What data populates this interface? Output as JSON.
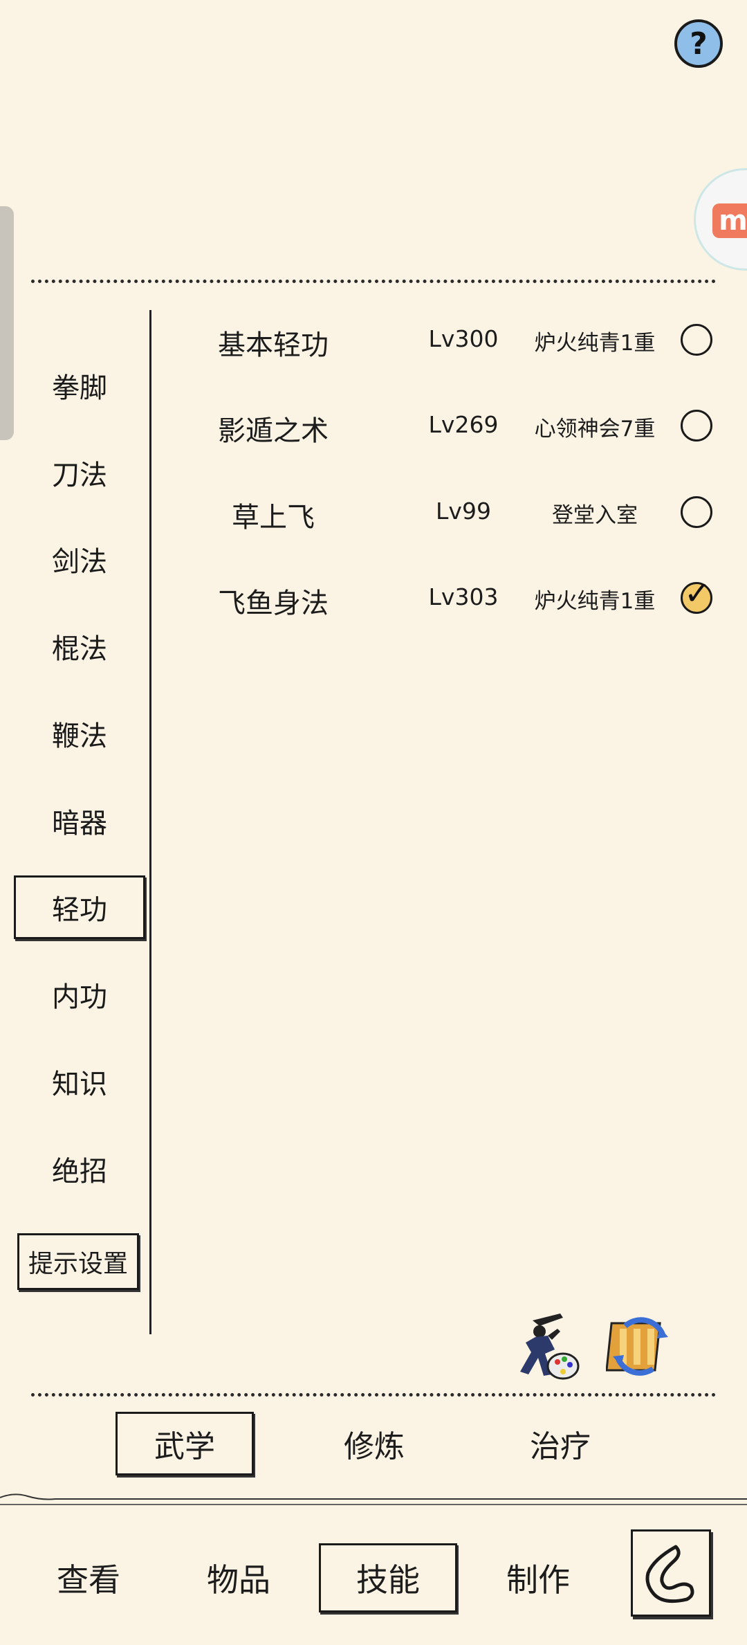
{
  "help": {
    "icon": "question-circle-icon",
    "label": "?"
  },
  "float_badge": {
    "icon": "app-logo-icon",
    "label": "m"
  },
  "categories": [
    {
      "label": "拳脚",
      "active": false
    },
    {
      "label": "刀法",
      "active": false
    },
    {
      "label": "剑法",
      "active": false
    },
    {
      "label": "棍法",
      "active": false
    },
    {
      "label": "鞭法",
      "active": false
    },
    {
      "label": "暗器",
      "active": false
    },
    {
      "label": "轻功",
      "active": true
    },
    {
      "label": "内功",
      "active": false
    },
    {
      "label": "知识",
      "active": false
    },
    {
      "label": "绝招",
      "active": false
    }
  ],
  "hint_button": "提示设置",
  "skills": [
    {
      "name": "基本轻功",
      "level": "Lv300",
      "rank": "炉火纯青1重",
      "equipped": false
    },
    {
      "name": "影遁之术",
      "level": "Lv269",
      "rank": "心领神会7重",
      "equipped": false
    },
    {
      "name": "草上飞",
      "level": "Lv99",
      "rank": "登堂入室",
      "equipped": false
    },
    {
      "name": "飞鱼身法",
      "level": "Lv303",
      "rank": "炉火纯青1重",
      "equipped": true
    }
  ],
  "tools": {
    "martial_icon": "swordsman-palette-icon",
    "scroll_icon": "scroll-swap-icon"
  },
  "subtabs": [
    {
      "label": "武学",
      "active": true
    },
    {
      "label": "修炼",
      "active": false
    },
    {
      "label": "治疗",
      "active": false
    }
  ],
  "navtabs": [
    {
      "label": "查看",
      "active": false
    },
    {
      "label": "物品",
      "active": false
    },
    {
      "label": "技能",
      "active": true
    },
    {
      "label": "制作",
      "active": false
    }
  ],
  "back": {
    "icon": "back-arrow-icon"
  },
  "colors": {
    "background": "#fbf4e4",
    "ink": "#1a1a1a",
    "help_blue": "#8fbfe8",
    "check_gold": "#f3c867"
  }
}
